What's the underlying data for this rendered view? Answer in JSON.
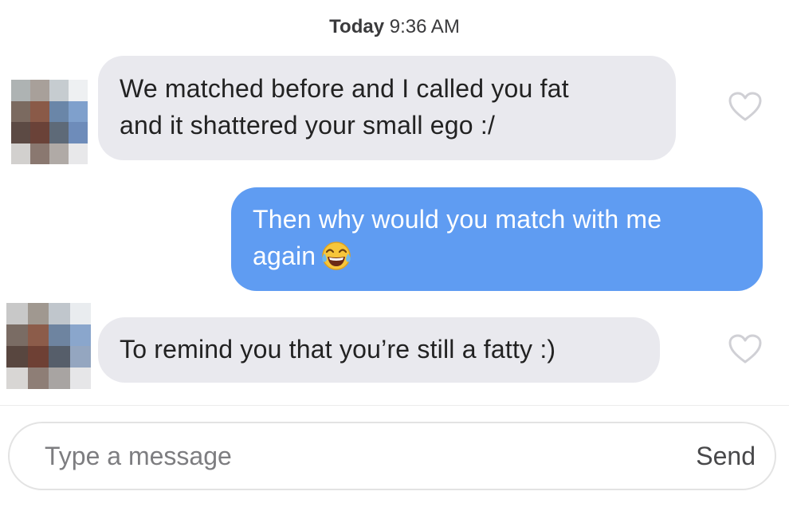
{
  "timestamp": {
    "day": "Today",
    "time": "9:36 AM"
  },
  "messages": [
    {
      "direction": "received",
      "lines": [
        "We matched before and I called you fat",
        "and it shattered your small ego :/"
      ],
      "liked": false
    },
    {
      "direction": "sent",
      "lines": [
        "Then why would you match with me",
        "again"
      ],
      "emoji": "face-with-tears-of-joy"
    },
    {
      "direction": "received",
      "lines": [
        "To remind you that you’re still a fatty :)"
      ],
      "liked": false
    }
  ],
  "composer": {
    "placeholder": "Type a message",
    "send_label": "Send"
  },
  "colors": {
    "received_bubble": "#e9e9ee",
    "sent_bubble": "#5f9cf2",
    "heart_outline": "#d0d0d5"
  }
}
